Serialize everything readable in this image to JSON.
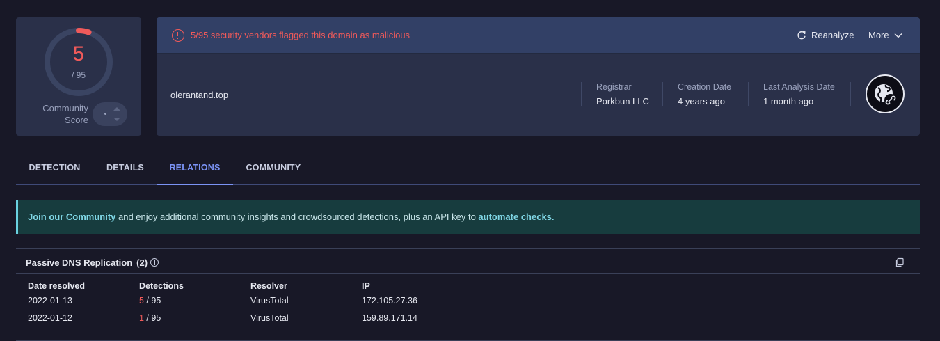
{
  "score": {
    "detections": "5",
    "total": "/ 95",
    "detection_fraction": 0.0526,
    "community_label": "Community Score",
    "community_value": ""
  },
  "alert": {
    "message": "5/95 security vendors flagged this domain as malicious",
    "reanalyze_label": "Reanalyze",
    "more_label": "More"
  },
  "domain": {
    "name": "olerantand.top",
    "registrar_label": "Registrar",
    "registrar_value": "Porkbun LLC",
    "creation_label": "Creation Date",
    "creation_value": "4 years ago",
    "analysis_label": "Last Analysis Date",
    "analysis_value": "1 month ago"
  },
  "tabs": [
    {
      "label": "DETECTION"
    },
    {
      "label": "DETAILS"
    },
    {
      "label": "RELATIONS",
      "active": true
    },
    {
      "label": "COMMUNITY"
    }
  ],
  "banner": {
    "link1": "Join our Community",
    "middle": " and enjoy additional community insights and crowdsourced detections, plus an API key to ",
    "link2": "automate checks."
  },
  "passive_dns": {
    "title": "Passive DNS Replication",
    "count": "(2)",
    "columns": [
      "Date resolved",
      "Detections",
      "Resolver",
      "IP"
    ],
    "rows": [
      {
        "date": "2022-01-13",
        "detections": "5",
        "total": " / 95",
        "resolver": "VirusTotal",
        "ip": "172.105.27.36"
      },
      {
        "date": "2022-01-12",
        "detections": "1",
        "total": " / 95",
        "resolver": "VirusTotal",
        "ip": "159.89.171.14"
      }
    ]
  },
  "colors": {
    "malicious": "#f05a5a",
    "accent": "#7b93f5",
    "banner_link": "#80d7e6"
  }
}
